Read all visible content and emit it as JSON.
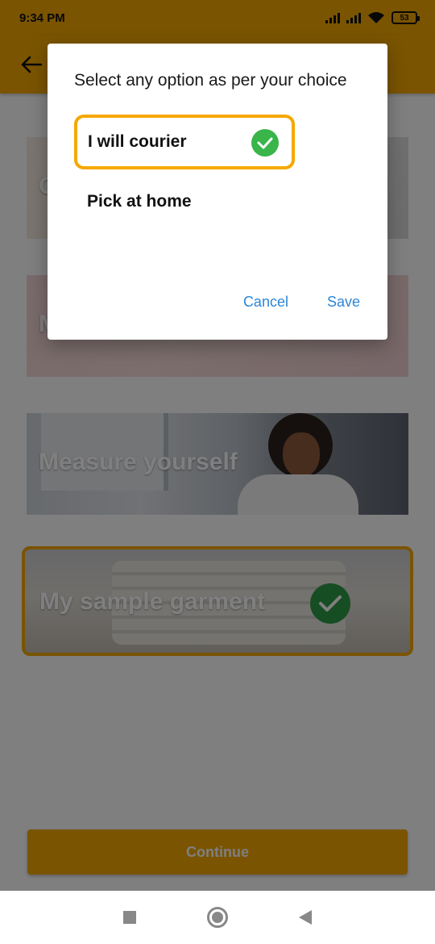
{
  "status_bar": {
    "time": "9:34 PM",
    "battery": "53"
  },
  "header": {
    "back_icon": "arrow-left-icon"
  },
  "cards": [
    {
      "label": "C",
      "selected": false
    },
    {
      "label": "M",
      "selected": false
    },
    {
      "label": "Measure yourself",
      "selected": false
    },
    {
      "label": "My sample garment",
      "selected": true
    }
  ],
  "continue_label": "Continue",
  "dialog": {
    "title": "Select any option as per your choice",
    "options": [
      {
        "label": "I will courier",
        "selected": true
      },
      {
        "label": "Pick at home",
        "selected": false
      }
    ],
    "cancel_label": "Cancel",
    "save_label": "Save"
  },
  "colors": {
    "accent": "#f5a800",
    "check_green": "#39b54a",
    "link_blue": "#2c86d6"
  }
}
